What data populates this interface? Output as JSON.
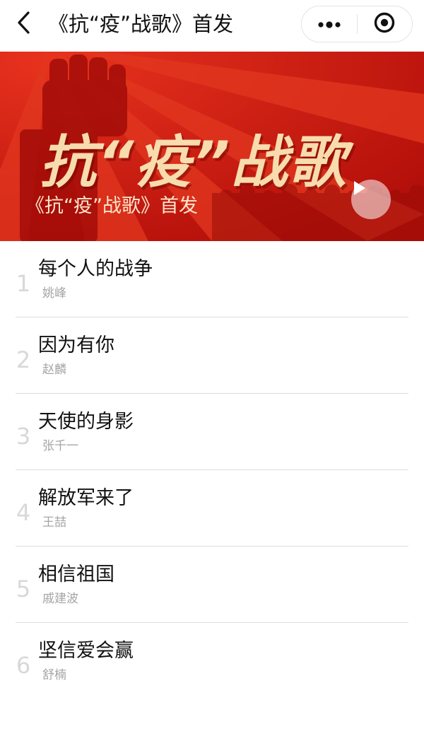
{
  "nav": {
    "title": "《抗“疫”战歌》首发",
    "back_icon": "chevron-left-icon",
    "more_icon": "more-dots-icon",
    "close_icon": "target-circle-icon"
  },
  "banner": {
    "headline": "抗“疫”战歌",
    "subtitle": "《抗“疫”战歌》首发",
    "play_icon": "play-icon",
    "colors": {
      "background": "#c7170f",
      "ray": "#e2371f",
      "headline": "#f7dcae"
    }
  },
  "songs": [
    {
      "index": "1",
      "title": "每个人的战争",
      "artist": "姚峰"
    },
    {
      "index": "2",
      "title": "因为有你",
      "artist": "赵麟"
    },
    {
      "index": "3",
      "title": "天使的身影",
      "artist": "张千一"
    },
    {
      "index": "4",
      "title": "解放军来了",
      "artist": "王喆"
    },
    {
      "index": "5",
      "title": "相信祖国",
      "artist": "戚建波"
    },
    {
      "index": "6",
      "title": "坚信爱会赢",
      "artist": "舒楠"
    }
  ]
}
